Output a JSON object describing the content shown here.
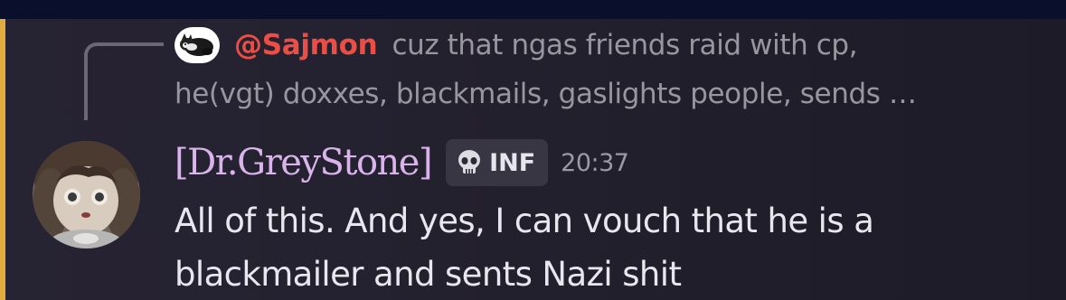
{
  "reply": {
    "author": "@Sajmon",
    "text_line1": "cuz that ngas friends raid with cp,",
    "text_line2": "he(vgt) doxxes, blackmails, gaslights people, sends …",
    "avatar_icon": "cat-avatar-icon"
  },
  "message": {
    "username": "[Dr.GreyStone]",
    "badge_icon": "skull-icon",
    "badge_label": "INF",
    "timestamp": "20:37",
    "text": "All of this. And yes, I can vouch that he is a blackmailer and sents Nazi shit",
    "avatar_icon": "doll-avatar-icon"
  },
  "colors": {
    "mention_stripe": "#e2ad3f",
    "reply_author": "#ea4e45",
    "username": "#d9b4ea",
    "top_bar": "#0a0f2c"
  }
}
